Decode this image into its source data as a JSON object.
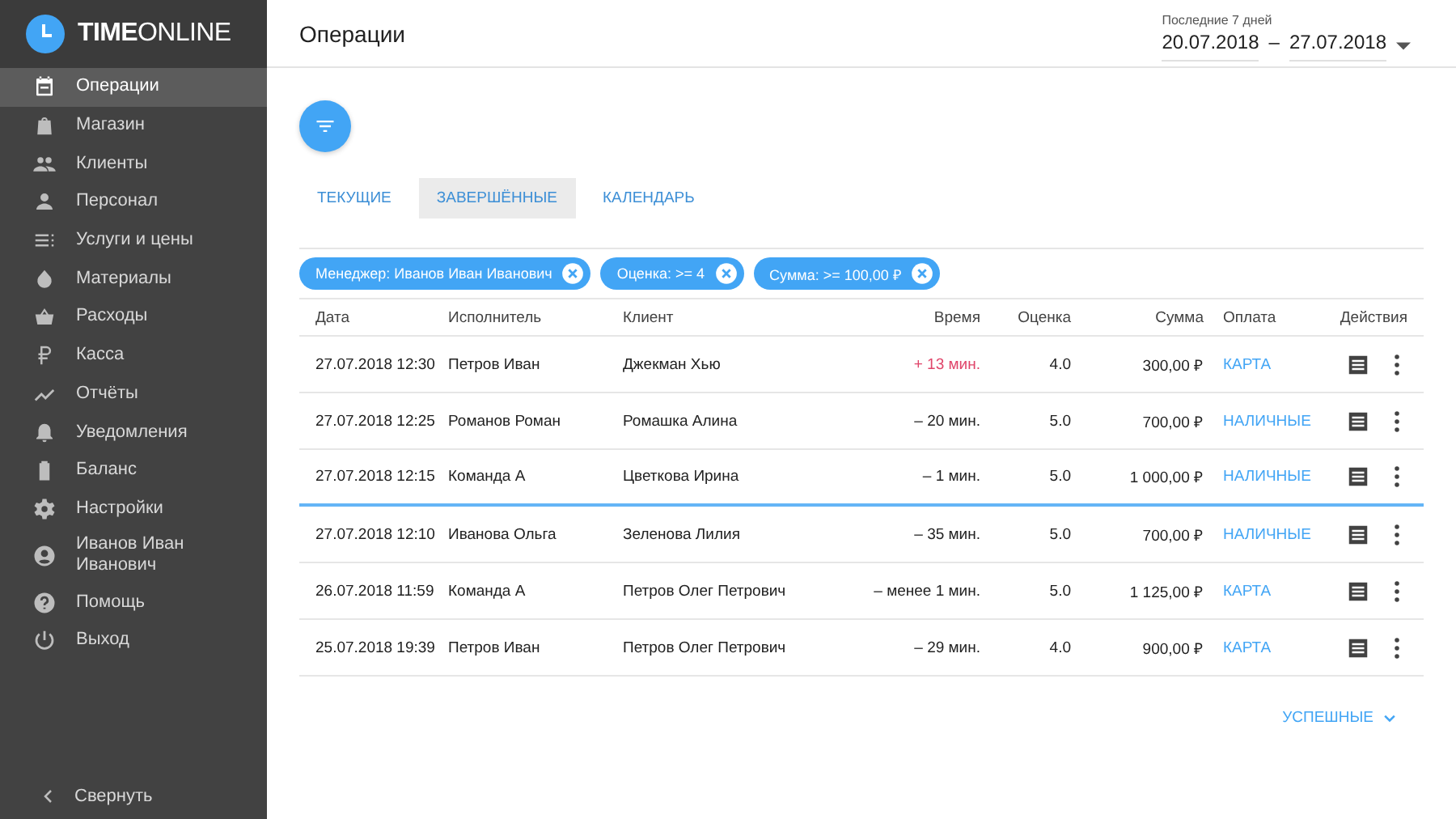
{
  "logo": {
    "text": "**TIME**ONLINE"
  },
  "sidebar": {
    "items": [
      {
        "label": "Операции",
        "selected": true
      },
      {
        "label": "Магазин",
        "selected": false
      },
      {
        "label": "Клиенты",
        "selected": false
      },
      {
        "label": "Персонал",
        "selected": false
      },
      {
        "label": "Услуги и цены",
        "selected": false
      },
      {
        "label": "Материалы",
        "selected": false
      },
      {
        "label": "Расходы",
        "selected": false
      },
      {
        "label": "Касса",
        "selected": false
      },
      {
        "label": "Отчёты",
        "selected": false
      },
      {
        "label": "Уведомления",
        "selected": false
      },
      {
        "label": "Баланс",
        "selected": false
      },
      {
        "label": "Настройки",
        "selected": false
      },
      {
        "label": "Иванов Иван Иванович",
        "selected": false
      },
      {
        "label": "Помощь",
        "selected": false
      },
      {
        "label": "Выход",
        "selected": false
      }
    ],
    "collapse": "Свернуть"
  },
  "header": {
    "title": "Операции",
    "period_label": "Последние 7 дней",
    "date_from": "20.07.2018",
    "separator": "–",
    "date_to": "27.07.2018"
  },
  "tabs": [
    {
      "label": "ТЕКУЩИЕ",
      "selected": false
    },
    {
      "label": "ЗАВЕРШЁННЫЕ",
      "selected": true
    },
    {
      "label": "КАЛЕНДАРЬ",
      "selected": false
    }
  ],
  "filters": [
    "Менеджер: Иванов Иван Иванович",
    "Оценка: >= 4",
    "Сумма: >= 100,00 ₽"
  ],
  "table": {
    "columns": [
      "Дата",
      "Исполнитель",
      "Клиент",
      "Время",
      "Оценка",
      "Сумма",
      "Оплата",
      "Действия"
    ],
    "rows": [
      {
        "date": "27.07.2018 12:30",
        "performer": "Петров Иван",
        "client": "Джекман Хью",
        "time": "+ 13 мин.",
        "late": true,
        "rating": "4.0",
        "sum": "300,00 ₽",
        "payment": "КАРТА",
        "selected": false
      },
      {
        "date": "27.07.2018 12:25",
        "performer": "Романов Роман",
        "client": "Ромашка Алина",
        "time": "– 20 мин.",
        "late": false,
        "rating": "5.0",
        "sum": "700,00 ₽",
        "payment": "НАЛИЧНЫЕ",
        "selected": false
      },
      {
        "date": "27.07.2018 12:15",
        "performer": "Команда А",
        "client": "Цветкова Ирина",
        "time": "– 1 мин.",
        "late": false,
        "rating": "5.0",
        "sum": "1 000,00 ₽",
        "payment": "НАЛИЧНЫЕ",
        "selected": true
      },
      {
        "date": "27.07.2018 12:10",
        "performer": "Иванова Ольга",
        "client": "Зеленова Лилия",
        "time": "– 35 мин.",
        "late": false,
        "rating": "5.0",
        "sum": "700,00 ₽",
        "payment": "НАЛИЧНЫЕ",
        "selected": false
      },
      {
        "date": "26.07.2018 11:59",
        "performer": "Команда А",
        "client": "Петров Олег Петрович",
        "time": "– менее 1 мин.",
        "late": false,
        "rating": "5.0",
        "sum": "1 125,00 ₽",
        "payment": "КАРТА",
        "selected": false
      },
      {
        "date": "25.07.2018 19:39",
        "performer": "Петров Иван",
        "client": "Петров Олег Петрович",
        "time": "– 29 мин.",
        "late": false,
        "rating": "4.0",
        "sum": "900,00 ₽",
        "payment": "КАРТА",
        "selected": false
      }
    ]
  },
  "footer_link": "УСПЕШНЫЕ"
}
